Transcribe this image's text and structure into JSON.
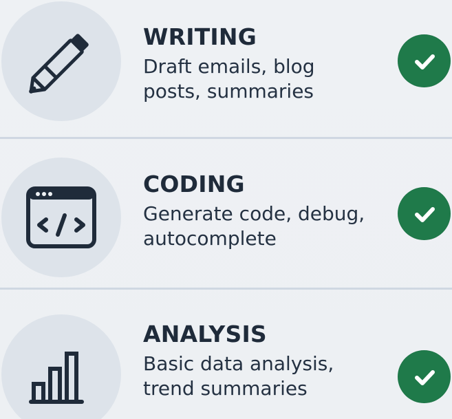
{
  "items": [
    {
      "title": "WRITING",
      "description": "Draft emails, blog posts, summaries",
      "icon": "pencil-icon",
      "status_icon": "check-icon"
    },
    {
      "title": "CODING",
      "description": "Generate code, debug, autocomplete",
      "icon": "code-window-icon",
      "status_icon": "check-icon"
    },
    {
      "title": "ANALYSIS",
      "description": "Basic data analysis, trend summaries",
      "icon": "bar-chart-icon",
      "status_icon": "check-icon"
    }
  ],
  "colors": {
    "background": "#eef1f4",
    "icon_circle": "#dde3ea",
    "text_primary": "#1f2b3a",
    "check_green": "#1f7a4a",
    "divider": "#cfd7e2"
  }
}
